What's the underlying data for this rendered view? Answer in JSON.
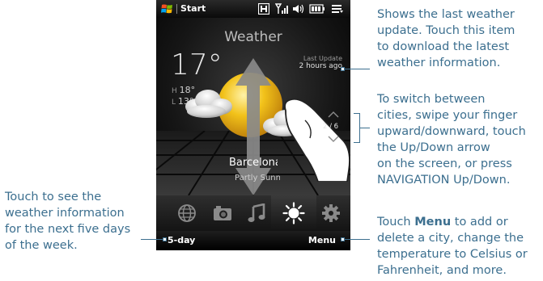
{
  "phone": {
    "title_bar": {
      "start_label": "Start",
      "icons": [
        "windows-logo-icon",
        "h-data-icon",
        "signal-icon",
        "volume-icon",
        "battery-icon",
        "menu-lines-icon"
      ]
    },
    "weather": {
      "header": "Weather",
      "temperature": "17°",
      "high_label": "H",
      "high_value": "18°",
      "low_label": "L",
      "low_value": "13°",
      "last_update_label": "Last Update",
      "last_update_value": "2 hours ago",
      "city_index": "2 / 6",
      "city": "Barcelona",
      "condition": "Partly Sunny"
    },
    "tabs": [
      {
        "name": "globe-tab-icon"
      },
      {
        "name": "camera-tab-icon"
      },
      {
        "name": "music-tab-icon"
      },
      {
        "name": "weather-tab-icon",
        "selected": true
      },
      {
        "name": "settings-tab-icon"
      }
    ],
    "softkeys": {
      "left": "5-day",
      "right": "Menu"
    }
  },
  "annotations": {
    "last_update": [
      "Shows the last weather",
      "update. Touch this item",
      "to download the latest",
      "weather information."
    ],
    "switch_cities": [
      "To switch between",
      "cities, swipe your finger",
      "upward/downward, touch",
      "the Up/Down arrow",
      "on the screen, or press",
      "NAVIGATION Up/Down."
    ],
    "five_day": [
      "Touch to see the",
      "weather information",
      "for the next five days",
      "of the week."
    ],
    "menu": {
      "line1_prefix": "Touch ",
      "line1_bold": "Menu",
      "line1_suffix": " to add or",
      "rest": [
        "delete a city, change the",
        "temperature to Celsius or",
        "Fahrenheit, and more."
      ]
    }
  },
  "colors": {
    "annotation": "#3c6f8f",
    "sun": "#f2c21a",
    "arrow": "#8a8a8a"
  }
}
